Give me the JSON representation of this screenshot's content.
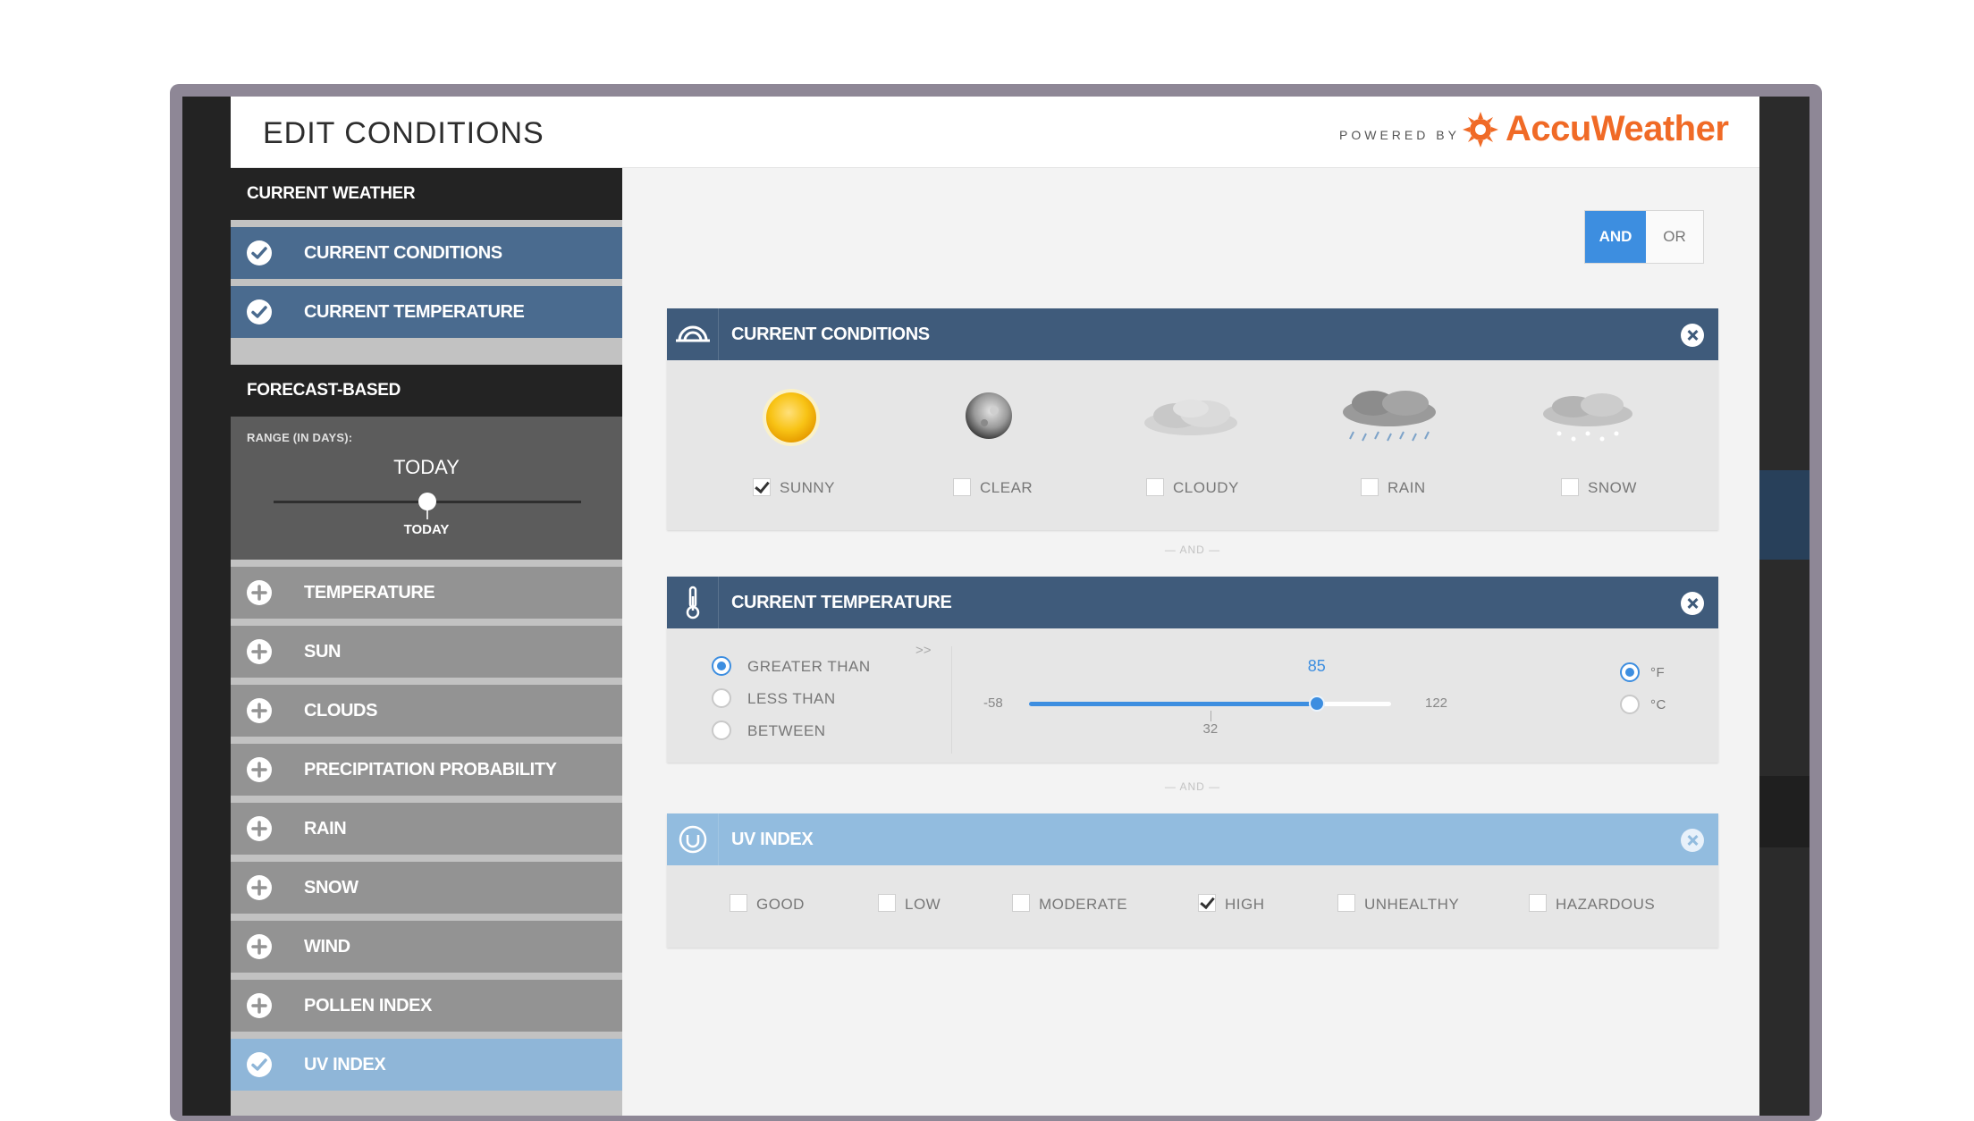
{
  "header": {
    "title": "EDIT CONDITIONS",
    "powered_by": "POWERED BY",
    "brand": "AccuWeather",
    "brand_color": "#f06a26"
  },
  "sidebar": {
    "current_weather_header": "CURRENT WEATHER",
    "current_items": [
      {
        "label": "CURRENT CONDITIONS",
        "icon": "check-icon",
        "state": "selected"
      },
      {
        "label": "CURRENT TEMPERATURE",
        "icon": "check-icon",
        "state": "selected"
      }
    ],
    "forecast_header": "FORECAST-BASED",
    "range": {
      "label": "RANGE (IN DAYS):",
      "value": "TODAY",
      "tick_label": "TODAY"
    },
    "forecast_items": [
      {
        "label": "TEMPERATURE",
        "icon": "plus-icon"
      },
      {
        "label": "SUN",
        "icon": "plus-icon"
      },
      {
        "label": "CLOUDS",
        "icon": "plus-icon"
      },
      {
        "label": "PRECIPITATION PROBABILITY",
        "icon": "plus-icon"
      },
      {
        "label": "RAIN",
        "icon": "plus-icon"
      },
      {
        "label": "SNOW",
        "icon": "plus-icon"
      },
      {
        "label": "WIND",
        "icon": "plus-icon"
      },
      {
        "label": "POLLEN INDEX",
        "icon": "plus-icon"
      },
      {
        "label": "UV INDEX",
        "icon": "check-icon",
        "state": "selected"
      }
    ]
  },
  "logic_toggle": {
    "and_label": "AND",
    "or_label": "OR",
    "selected": "AND",
    "accent": "#3d8ee0"
  },
  "panels": {
    "conditions": {
      "title": "CURRENT CONDITIONS",
      "options": [
        {
          "label": "SUNNY",
          "checked": true,
          "icon": "sun-icon"
        },
        {
          "label": "CLEAR",
          "checked": false,
          "icon": "moon-icon"
        },
        {
          "label": "CLOUDY",
          "checked": false,
          "icon": "cloud-icon"
        },
        {
          "label": "RAIN",
          "checked": false,
          "icon": "rain-cloud-icon"
        },
        {
          "label": "SNOW",
          "checked": false,
          "icon": "snow-cloud-icon"
        }
      ]
    },
    "and_separator": "— AND —",
    "temperature": {
      "title": "CURRENT TEMPERATURE",
      "modes": [
        {
          "label": "GREATER THAN",
          "selected": true
        },
        {
          "label": "LESS THAN",
          "selected": false
        },
        {
          "label": "BETWEEN",
          "selected": false
        }
      ],
      "expand_glyph": ">>",
      "min": -58,
      "max": 122,
      "value": 85,
      "marker": 32,
      "units": [
        {
          "label": "°F",
          "selected": true
        },
        {
          "label": "°C",
          "selected": false
        }
      ]
    },
    "uv": {
      "title": "UV INDEX",
      "options": [
        {
          "label": "GOOD",
          "checked": false
        },
        {
          "label": "LOW",
          "checked": false
        },
        {
          "label": "MODERATE",
          "checked": false
        },
        {
          "label": "HIGH",
          "checked": true
        },
        {
          "label": "UNHEALTHY",
          "checked": false
        },
        {
          "label": "HAZARDOUS",
          "checked": false
        }
      ]
    }
  },
  "colors": {
    "panel_header": "#3f5b7b",
    "uv_header": "#92bcdf",
    "sidebar_active": "#4a6b8f"
  }
}
